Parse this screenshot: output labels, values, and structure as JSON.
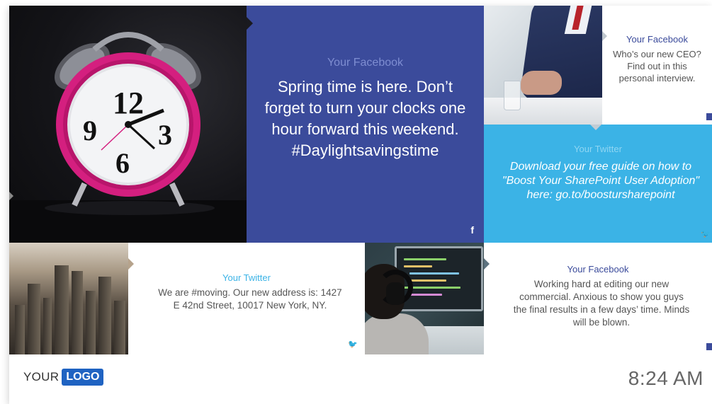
{
  "tiles": {
    "clock_photo": {
      "alt": "alarm clock photo"
    },
    "fb_big": {
      "source": "Your Facebook",
      "message": "Spring time is here. Don’t forget to turn your clocks one hour forward this weekend. #Daylightsavingstime",
      "icon": "f"
    },
    "fb_ceo": {
      "source": "Your Facebook",
      "message": "Who’s our new CEO? Find out in this personal interview."
    },
    "tw_blue": {
      "source": "Your Twitter",
      "message": "Download your free guide on how to \"Boost Your SharePoint User Adoption\" here: go.to/boostursharepoint",
      "icon": "🐦"
    },
    "tw_white": {
      "source": "Your Twitter",
      "message": "We are #moving. Our new address is: 1427 E 42nd Street, 10017 New York, NY.",
      "icon": "🐦"
    },
    "fb_white": {
      "source": "Your Facebook",
      "message": "Working hard at editing our new commercial. Anxious to show you guys the final results in a few days’ time. Minds will be blown."
    }
  },
  "footer": {
    "logo_text": "YOUR",
    "logo_badge": "LOGO",
    "time": "8:24 AM"
  },
  "colors": {
    "facebook_blue": "#3b4b9b",
    "twitter_blue": "#3bb3e6",
    "logo_blue": "#1f63c2"
  }
}
